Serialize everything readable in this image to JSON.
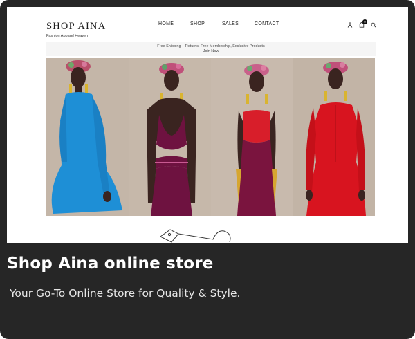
{
  "site": {
    "brand_name": "SHOP AINA",
    "brand_tagline": "Fashion Apparel Heaven",
    "nav": [
      "HOME",
      "SHOP",
      "SALES",
      "CONTACT"
    ],
    "active_nav": "HOME",
    "cart_count": "0",
    "promo_line1": "Free Shipping + Returns, Free Membership, Exclusive Products",
    "promo_line2": "Join Now",
    "icons": [
      "user-icon",
      "cart-icon",
      "search-icon"
    ]
  },
  "hero": {
    "panels": [
      {
        "dress": "#1e8fd6",
        "bg": "#c4b6a8"
      },
      {
        "dress": "#6e1240",
        "bg": "#c6b8aa"
      },
      {
        "dress": "#7a143e",
        "top": "#d81e2a",
        "bg": "#c8baad"
      },
      {
        "dress": "#d8141f",
        "bg": "#c2b4a6"
      }
    ]
  },
  "card": {
    "title": "Shop Aina online store",
    "subtitle": "Your Go-To Online Store for Quality & Style."
  }
}
